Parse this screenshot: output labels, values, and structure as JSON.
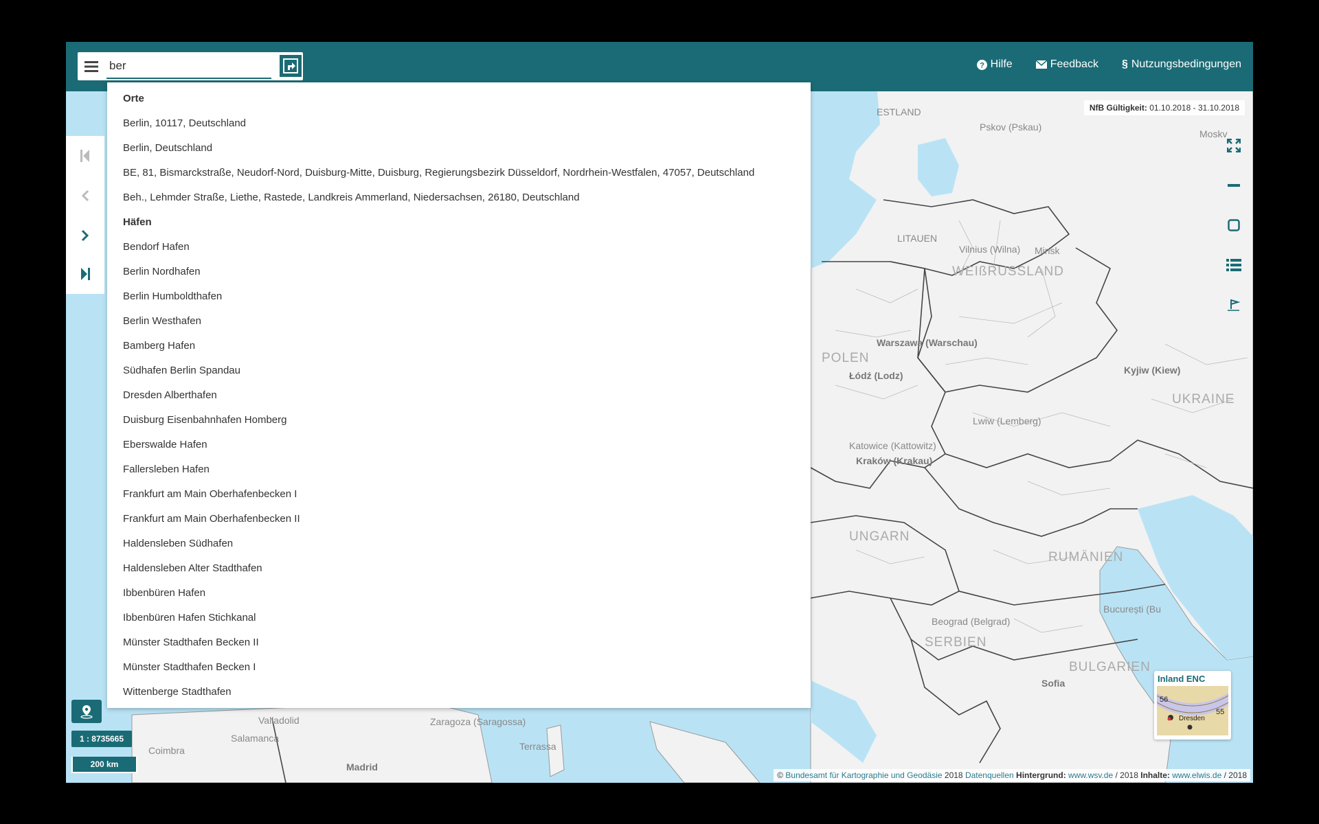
{
  "search": {
    "value": "ber"
  },
  "header": {
    "links": [
      {
        "icon": "question-circle-icon",
        "label": "Hilfe"
      },
      {
        "icon": "envelope-icon",
        "label": "Feedback"
      },
      {
        "icon": "paragraph-icon",
        "label": "Nutzungsbedingungen"
      }
    ]
  },
  "dropdown": {
    "places_heading": "Orte",
    "places": [
      "Berlin, 10117, Deutschland",
      "Berlin, Deutschland",
      "BE, 81, Bismarckstraße, Neudorf-Nord, Duisburg-Mitte, Duisburg, Regierungsbezirk Düsseldorf, Nordrhein-Westfalen, 47057, Deutschland",
      "Beh., Lehmder Straße, Liethe, Rastede, Landkreis Ammerland, Niedersachsen, 26180, Deutschland"
    ],
    "ports_heading": "Häfen",
    "ports": [
      "Bendorf Hafen",
      "Berlin Nordhafen",
      "Berlin Humboldthafen",
      "Berlin Westhafen",
      "Bamberg Hafen",
      "Südhafen Berlin Spandau",
      "Dresden Alberthafen",
      "Duisburg Eisenbahnhafen Homberg",
      "Eberswalde Hafen",
      "Fallersleben Hafen",
      "Frankfurt am Main Oberhafenbecken I",
      "Frankfurt am Main Oberhafenbecken II",
      "Haldensleben Südhafen",
      "Haldensleben Alter Stadthafen",
      "Ibbenbüren Hafen",
      "Ibbenbüren Hafen Stichkanal",
      "Münster Stadthafen Becken II",
      "Münster Stadthafen Becken I",
      "Wittenberge Stadthafen"
    ]
  },
  "validity": {
    "label": "NfB Gültigkeit:",
    "value": "01.10.2018 - 31.10.2018"
  },
  "scale": {
    "ratio": "1 : 8735665",
    "bar": "200 km"
  },
  "enc": {
    "title": "Inland ENC",
    "num_left": "56",
    "num_right": "55",
    "city": "Dresden"
  },
  "attribution": {
    "copyright": "©",
    "bkg": "Bundesamt für Kartographie und Geodäsie",
    "year1": "2018",
    "datasources": "Datenquellen",
    "bg_label": "Hintergrund:",
    "bg_link": "www.wsv.de",
    "year2": "/ 2018",
    "content_label": "Inhalte:",
    "content_link": "www.elwis.de",
    "year3": "/ 2018"
  },
  "map_labels": {
    "estland": "ESTLAND",
    "pskov": "Pskov (Pskau)",
    "moskva": "Moskv",
    "litauen": "LITAUEN",
    "weissrussland": "WEIßRUSSLAND",
    "vilnius": "Vilnius (Wilna)",
    "minsk": "Minsk",
    "polen": "POLEN",
    "warszawa": "Warszawa (Warschau)",
    "lodz": "Łódź (Lodz)",
    "krakow": "Kraków (Krakau)",
    "katowice": "Katowice (Kattowitz)",
    "ukraine": "UKRAINE",
    "kyjiw": "Kyjiw (Kiew)",
    "lviv": "Lwiw (Lemberg)",
    "rumaenien": "RUMÄNIEN",
    "bucuresti": "București (Bu",
    "belgrad": "Beograd (Belgrad)",
    "bulgarien": "BULGARIEN",
    "sofia": "Sofia",
    "serbien": "SERBIEN",
    "ungarn": "UNGARN",
    "madrid": "Madrid",
    "valladolid": "Valladolid",
    "salamanca": "Salamanca",
    "zaragoza": "Zaragoza (Saragossa)",
    "terrassa": "Terrassa",
    "coimbra": "Coimbra"
  }
}
